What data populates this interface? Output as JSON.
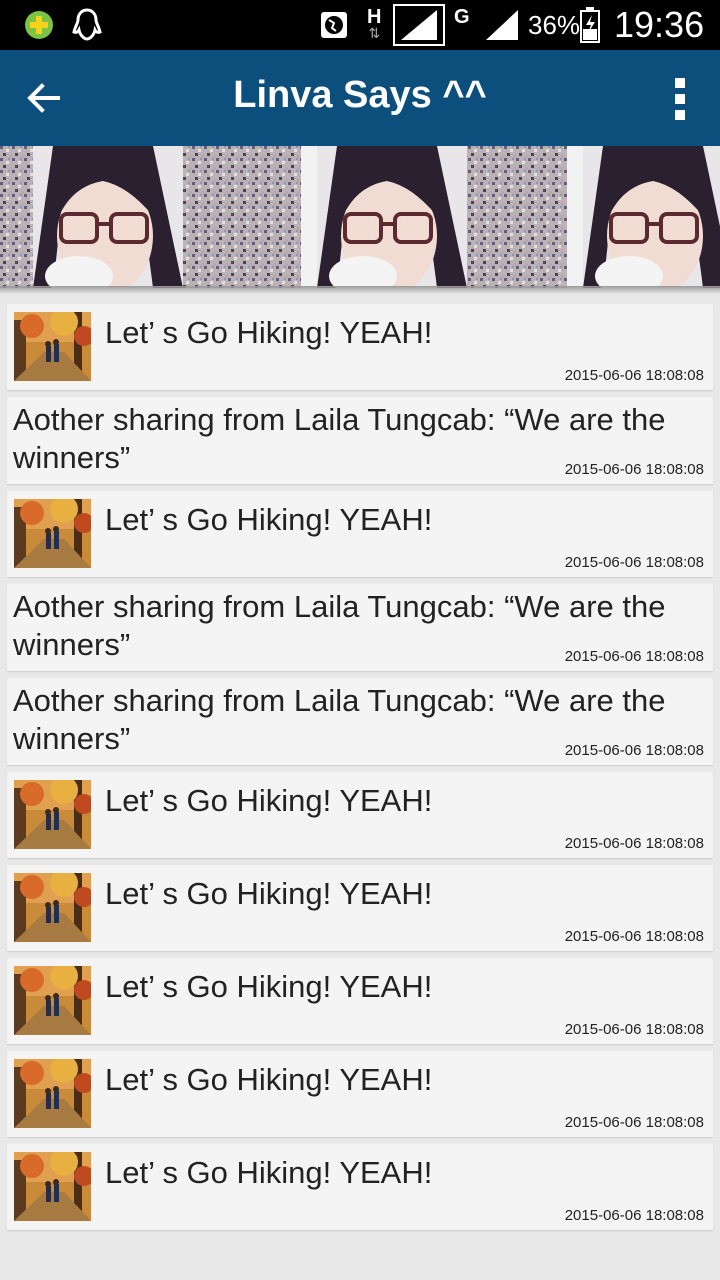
{
  "status_bar": {
    "network_type_1": "H",
    "network_type_2": "G",
    "battery_percent": "36%",
    "time": "19:36",
    "icons": [
      "app-notification-icon",
      "qq-penguin-icon",
      "globe-sync-icon",
      "signal-icon",
      "signal-icon",
      "battery-icon"
    ]
  },
  "app_bar": {
    "title": "Linva Says ^^",
    "back_icon": "arrow-left-icon",
    "overflow_icon": "more-vertical-icon",
    "color": "#0c4f7c"
  },
  "banner": {
    "description_icon": "profile-photo-collage"
  },
  "posts": [
    {
      "type": "image",
      "title": "Let’ s Go Hiking! YEAH!",
      "time": "2015-06-06 18:08:08"
    },
    {
      "type": "text",
      "title": "Aother sharing from Laila Tungcab: “We are the winners”",
      "time": "2015-06-06 18:08:08"
    },
    {
      "type": "image",
      "title": "Let’ s Go Hiking! YEAH!",
      "time": "2015-06-06 18:08:08"
    },
    {
      "type": "text",
      "title": "Aother sharing from Laila Tungcab: “We are the winners”",
      "time": "2015-06-06 18:08:08"
    },
    {
      "type": "text",
      "title": "Aother sharing from Laila Tungcab: “We are the winners”",
      "time": "2015-06-06 18:08:08"
    },
    {
      "type": "image",
      "title": "Let’ s Go Hiking! YEAH!",
      "time": "2015-06-06 18:08:08"
    },
    {
      "type": "image",
      "title": "Let’ s Go Hiking! YEAH!",
      "time": "2015-06-06 18:08:08"
    },
    {
      "type": "image",
      "title": "Let’ s Go Hiking! YEAH!",
      "time": "2015-06-06 18:08:08"
    },
    {
      "type": "image",
      "title": "Let’ s Go Hiking! YEAH!",
      "time": "2015-06-06 18:08:08"
    },
    {
      "type": "image",
      "title": "Let’ s Go Hiking! YEAH!",
      "time": "2015-06-06 18:08:08"
    }
  ]
}
